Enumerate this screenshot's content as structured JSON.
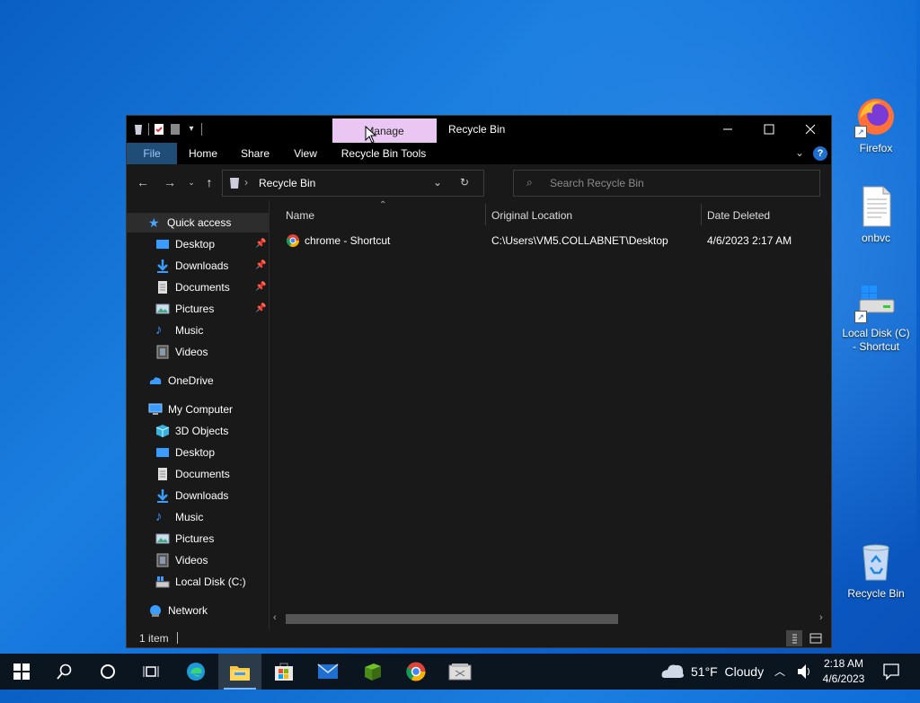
{
  "desktop": {
    "icons": [
      {
        "label": "Firefox"
      },
      {
        "label": "onbvc"
      },
      {
        "label_line1": "Local Disk (C)",
        "label_line2": "- Shortcut"
      },
      {
        "label": "Recycle Bin"
      }
    ]
  },
  "window": {
    "title": "Recycle Bin",
    "contextual_tab": "Manage",
    "ribbon_tabs": [
      "File",
      "Home",
      "Share",
      "View",
      "Recycle Bin Tools"
    ],
    "address_crumb": "Recycle Bin",
    "search_placeholder": "Search Recycle Bin",
    "columns": [
      "Name",
      "Original Location",
      "Date Deleted"
    ],
    "files": [
      {
        "name": "chrome - Shortcut",
        "original_location": "C:\\Users\\VM5.COLLABNET\\Desktop",
        "date_deleted": "4/6/2023 2:17 AM"
      }
    ],
    "status_text": "1 item"
  },
  "nav_pane": {
    "quick_access": "Quick access",
    "quick_items": [
      "Desktop",
      "Downloads",
      "Documents",
      "Pictures",
      "Music",
      "Videos"
    ],
    "onedrive": "OneDrive",
    "my_computer": "My Computer",
    "computer_items": [
      "3D Objects",
      "Desktop",
      "Documents",
      "Downloads",
      "Music",
      "Pictures",
      "Videos",
      "Local Disk (C:)"
    ],
    "network": "Network"
  },
  "taskbar": {
    "weather": "51°F  Cloudy",
    "time": "2:18 AM",
    "date": "4/6/2023"
  },
  "colors": {
    "accent": "#7ab8ff",
    "manage_tab": "#e9c7f2",
    "window_bg": "#191919",
    "desktop": "#0d6ad6"
  }
}
